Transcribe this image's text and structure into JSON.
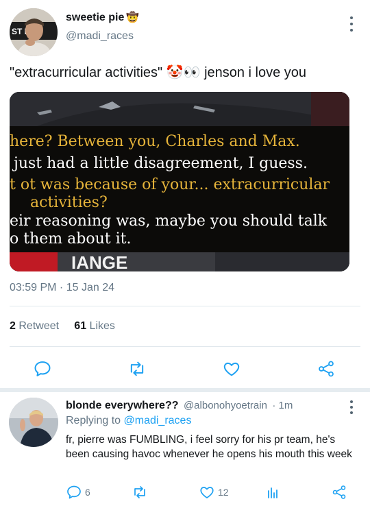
{
  "tweet": {
    "display_name": "sweetie pie",
    "name_emoji": "🤠",
    "handle": "@madi_races",
    "text": "\"extracurricular activities\" 🤡👀 jenson i love you",
    "timestamp": "03:59 PM · 15 Jan 24",
    "retweets_count": "2",
    "retweets_label": "Retweet",
    "likes_count": "61",
    "likes_label": "Likes",
    "avatar_shirt_text": "ST    BA"
  },
  "media": {
    "lower_text": "IANGE",
    "captions": [
      {
        "text": "here? Between you, Charles and Max.",
        "color": "#e6b43a"
      },
      {
        "text": "just had a little disagreement, I guess.",
        "color": "#ffffff"
      },
      {
        "text": "t ot was because of your... extracurricular",
        "color": "#e6b43a"
      },
      {
        "text": "activities?",
        "color": "#e6b43a"
      },
      {
        "text": "eir reasoning was, maybe you should talk",
        "color": "#ffffff"
      },
      {
        "text": "o them about it.",
        "color": "#ffffff"
      }
    ]
  },
  "actions": [
    "reply-icon",
    "retweet-icon",
    "like-icon",
    "share-icon"
  ],
  "reply": {
    "display_name": "blonde everywhere??",
    "handle": "@albonohyoetrain",
    "time": "· 1m",
    "replying_label": "Replying to",
    "replying_to": "@madi_races",
    "text": "fr, pierre was FUMBLING, i feel sorry for his pr team, he's been causing havoc whenever he opens his mouth this week",
    "reply_count": "6",
    "like_count": "12"
  },
  "colors": {
    "accent": "#1da1f2",
    "muted": "#657786",
    "caption_yellow": "#e6b43a"
  }
}
